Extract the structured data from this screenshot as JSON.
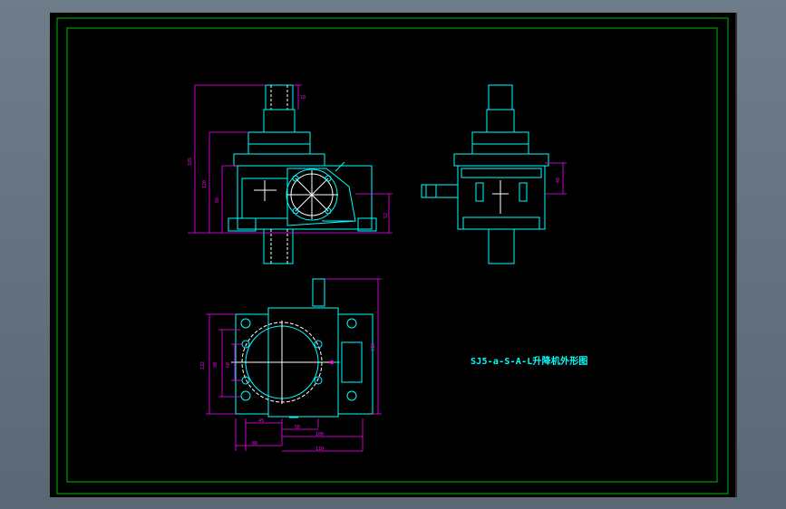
{
  "drawing": {
    "caption": "SJ5-a-S-A-L升降机外形图",
    "colors": {
      "background": "#000000",
      "frame": "#00c000",
      "outline": "#00ffff",
      "hidden": "#ffffff",
      "dimension": "#ff00ff"
    },
    "front_view": {
      "dims": {
        "overall_height": "185",
        "mid_height": "120",
        "lower_height": "88",
        "top_shaft": "18",
        "right_height": "52"
      }
    },
    "side_view": {
      "dims": {
        "right_height": "48"
      }
    },
    "top_view": {
      "dims": {
        "left_overall": "132",
        "left_mid": "90",
        "left_inner": "60",
        "right_height": "118",
        "b1": "45",
        "b2": "50",
        "b3": "80",
        "b4": "100",
        "b5": "110"
      }
    }
  }
}
